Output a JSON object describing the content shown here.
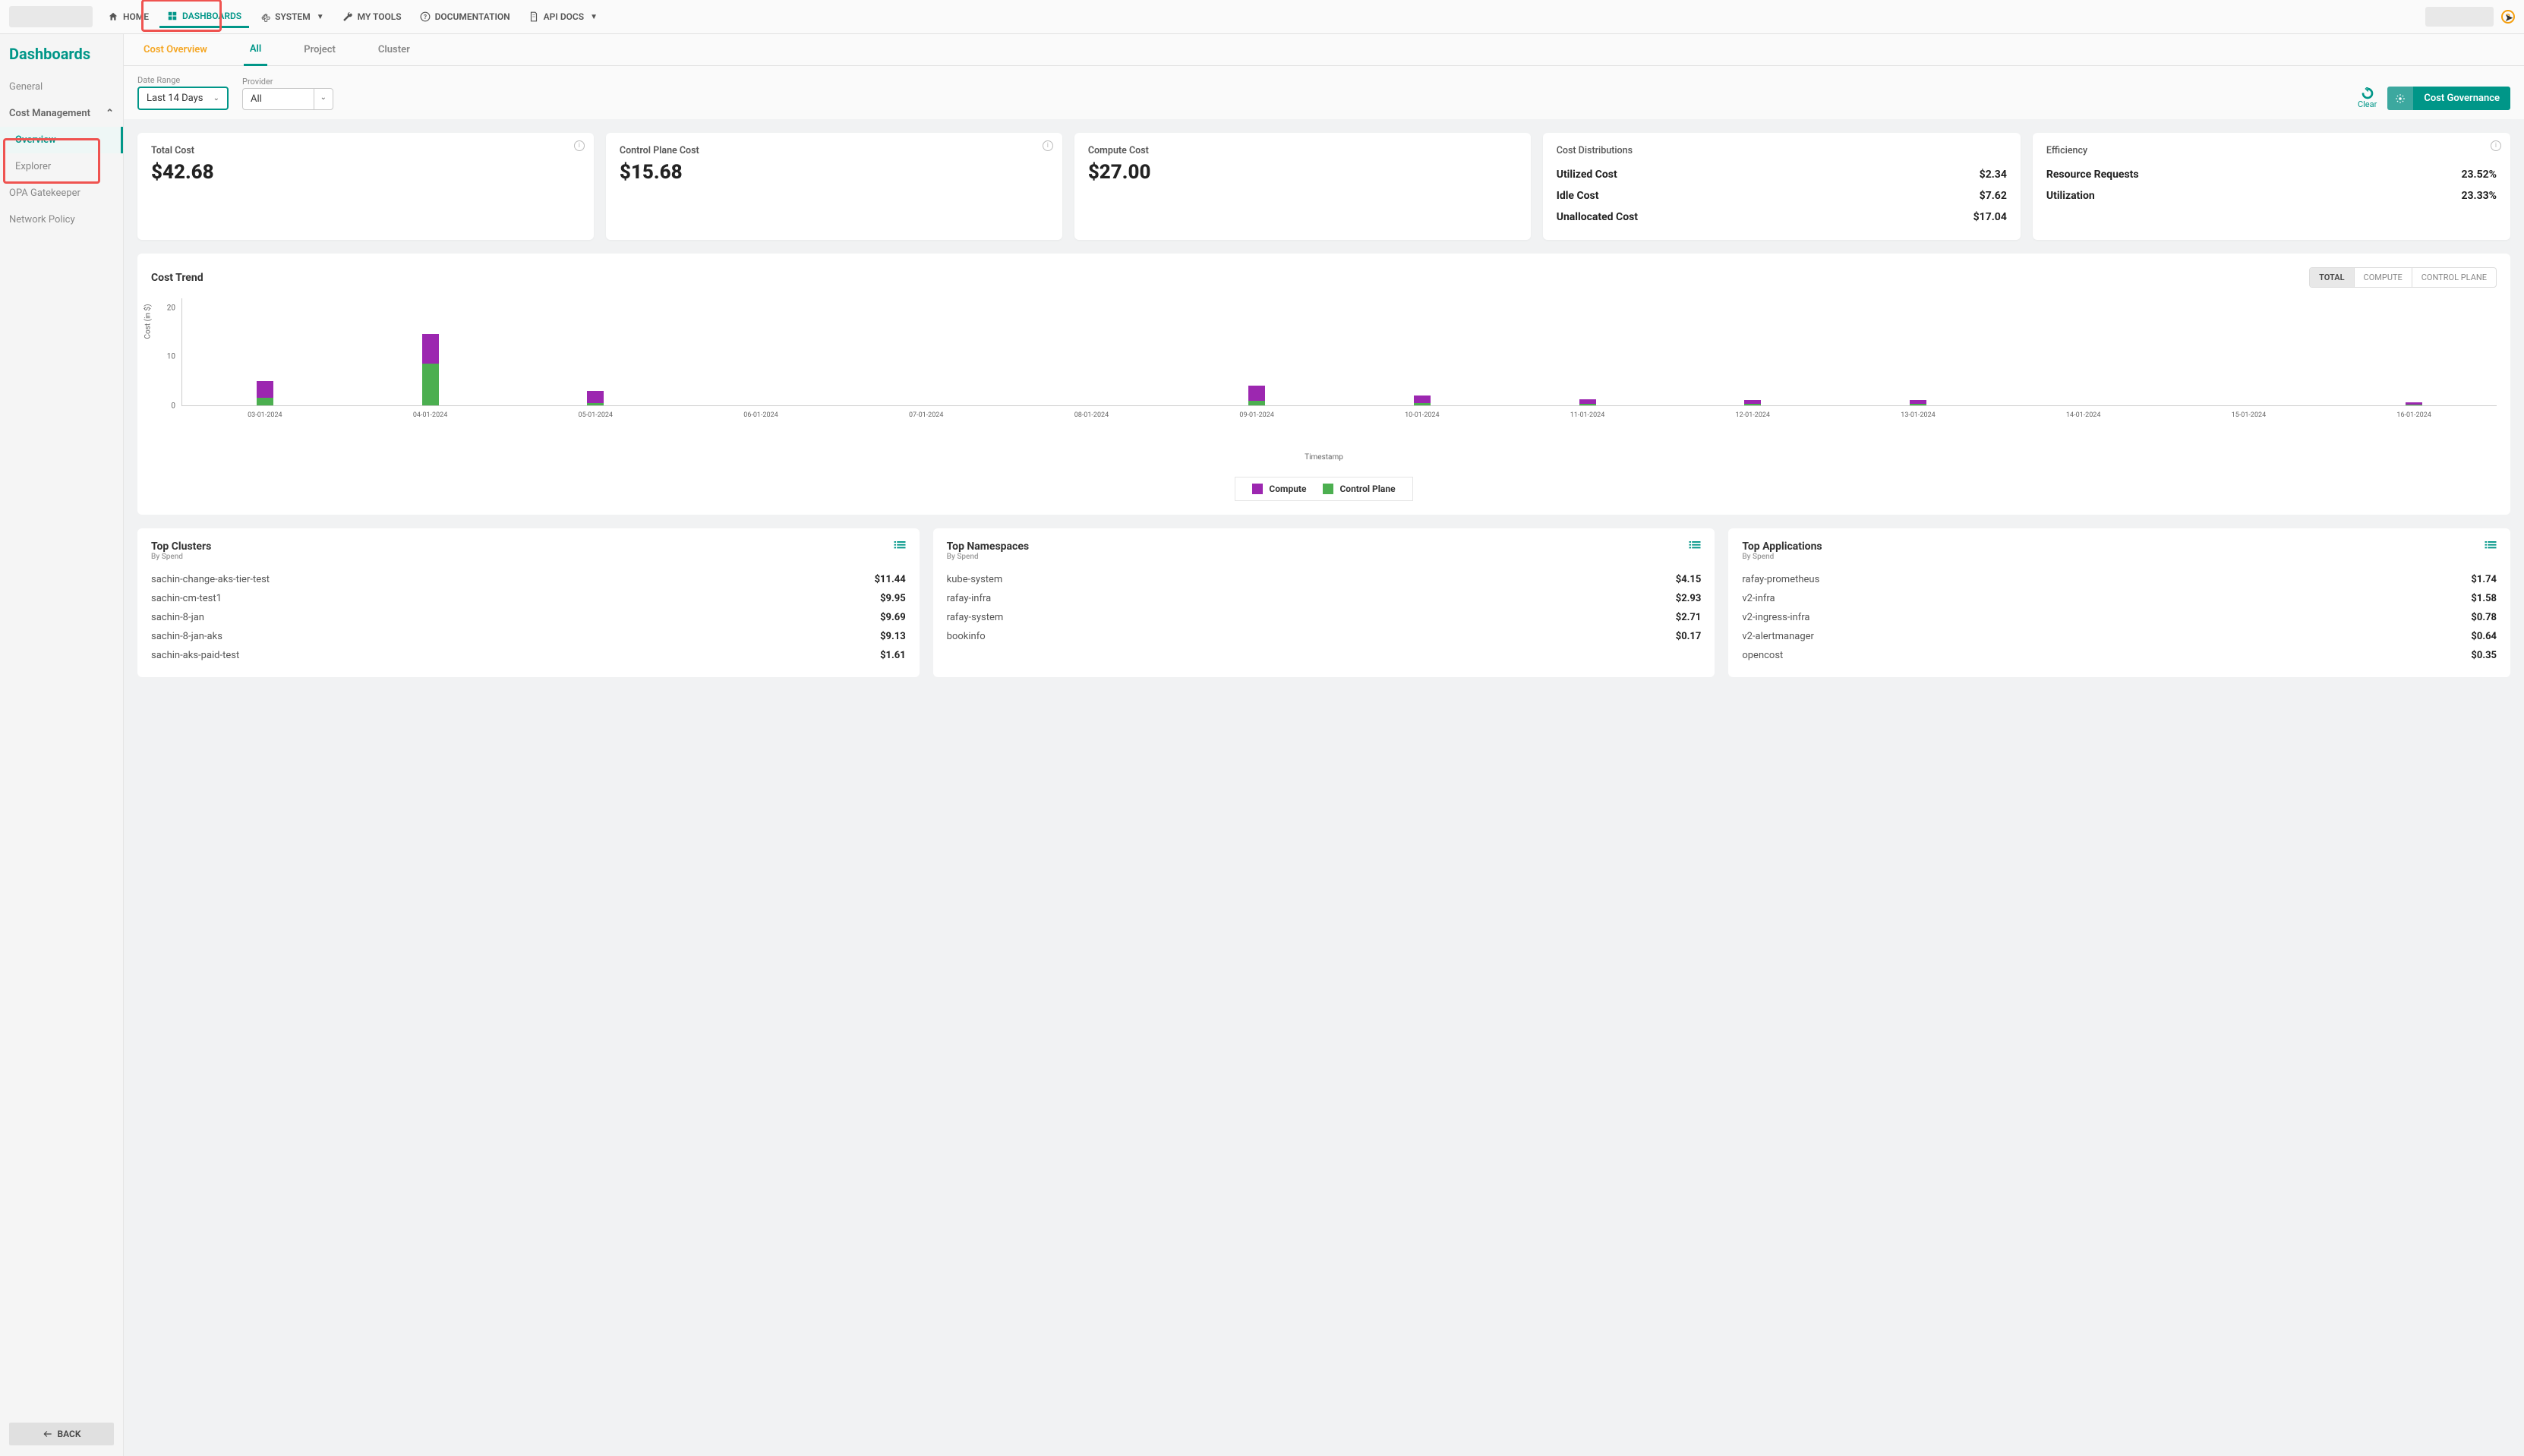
{
  "top_nav": {
    "home": "HOME",
    "dashboards": "DASHBOARDS",
    "system": "SYSTEM",
    "my_tools": "MY TOOLS",
    "documentation": "DOCUMENTATION",
    "api_docs": "API DOCS"
  },
  "sidebar": {
    "title": "Dashboards",
    "general": "General",
    "cost_management": "Cost Management",
    "overview": "Overview",
    "explorer": "Explorer",
    "opa": "OPA Gatekeeper",
    "network_policy": "Network Policy",
    "back": "BACK"
  },
  "tabs": {
    "cost_overview": "Cost Overview",
    "all": "All",
    "project": "Project",
    "cluster": "Cluster"
  },
  "filters": {
    "date_range_label": "Date Range",
    "date_range_value": "Last 14 Days",
    "provider_label": "Provider",
    "provider_value": "All",
    "clear": "Clear",
    "cost_governance": "Cost Governance"
  },
  "summary": {
    "total_cost_label": "Total Cost",
    "total_cost_value": "$42.68",
    "control_plane_label": "Control Plane Cost",
    "control_plane_value": "$15.68",
    "compute_label": "Compute Cost",
    "compute_value": "$27.00",
    "distributions_label": "Cost Distributions",
    "utilized_label": "Utilized Cost",
    "utilized_value": "$2.34",
    "idle_label": "Idle Cost",
    "idle_value": "$7.62",
    "unallocated_label": "Unallocated Cost",
    "unallocated_value": "$17.04",
    "efficiency_label": "Efficiency",
    "resource_req_label": "Resource Requests",
    "resource_req_value": "23.52%",
    "utilization_label": "Utilization",
    "utilization_value": "23.33%"
  },
  "chart": {
    "title": "Cost Trend",
    "seg_total": "TOTAL",
    "seg_compute": "COMPUTE",
    "seg_cp": "CONTROL PLANE",
    "y_label": "Cost (in $)",
    "x_label": "Timestamp",
    "legend_compute": "Compute",
    "legend_cp": "Control Plane"
  },
  "chart_data": {
    "type": "bar",
    "categories": [
      "03-01-2024",
      "04-01-2024",
      "05-01-2024",
      "06-01-2024",
      "07-01-2024",
      "08-01-2024",
      "09-01-2024",
      "10-01-2024",
      "11-01-2024",
      "12-01-2024",
      "13-01-2024",
      "14-01-2024",
      "15-01-2024",
      "16-01-2024"
    ],
    "series": [
      {
        "name": "Compute",
        "values": [
          3.5,
          6.0,
          2.5,
          0,
          0,
          0,
          3.0,
          1.5,
          1.0,
          0.8,
          0.8,
          0,
          0,
          0.5
        ]
      },
      {
        "name": "Control Plane",
        "values": [
          1.5,
          8.5,
          0.5,
          0,
          0,
          0,
          1.0,
          0.5,
          0.3,
          0.3,
          0.3,
          0,
          0,
          0.2
        ]
      }
    ],
    "y_ticks": [
      0,
      10,
      20
    ],
    "ylim": [
      0,
      22
    ],
    "ylabel": "Cost (in $)",
    "xlabel": "Timestamp"
  },
  "lists": {
    "clusters_title": "Top Clusters",
    "by_spend": "By Spend",
    "namespaces_title": "Top Namespaces",
    "apps_title": "Top Applications",
    "clusters": [
      {
        "name": "sachin-change-aks-tier-test",
        "value": "$11.44"
      },
      {
        "name": "sachin-cm-test1",
        "value": "$9.95"
      },
      {
        "name": "sachin-8-jan",
        "value": "$9.69"
      },
      {
        "name": "sachin-8-jan-aks",
        "value": "$9.13"
      },
      {
        "name": "sachin-aks-paid-test",
        "value": "$1.61"
      }
    ],
    "namespaces": [
      {
        "name": "kube-system",
        "value": "$4.15"
      },
      {
        "name": "rafay-infra",
        "value": "$2.93"
      },
      {
        "name": "rafay-system",
        "value": "$2.71"
      },
      {
        "name": "bookinfo",
        "value": "$0.17"
      }
    ],
    "apps": [
      {
        "name": "rafay-prometheus",
        "value": "$1.74"
      },
      {
        "name": "v2-infra",
        "value": "$1.58"
      },
      {
        "name": "v2-ingress-infra",
        "value": "$0.78"
      },
      {
        "name": "v2-alertmanager",
        "value": "$0.64"
      },
      {
        "name": "opencost",
        "value": "$0.35"
      }
    ]
  }
}
